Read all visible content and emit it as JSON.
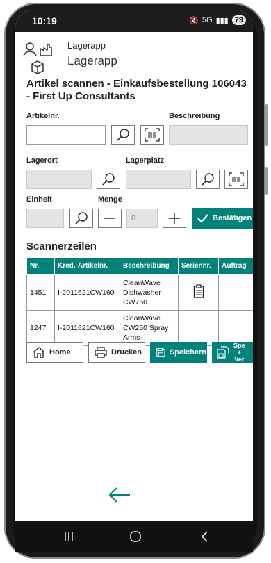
{
  "status": {
    "time": "10:19",
    "signal": "5G",
    "battery": "79"
  },
  "app": {
    "name_small": "Lagerapp",
    "name_large": "Lagerapp"
  },
  "page": {
    "title": "Artikel scannen - Einkaufsbestellung 106043 - First Up Consultants"
  },
  "form": {
    "artikelnr_label": "Artikelnr.",
    "artikelnr_value": "",
    "beschreibung_label": "Beschreibung",
    "lagerort_label": "Lagerort",
    "lagerplatz_label": "Lagerplatz",
    "einheit_label": "Einheit",
    "menge_label": "Menge",
    "menge_value": "0",
    "confirm_label": "Bestätigen"
  },
  "scanner": {
    "title": "Scannerzeilen",
    "columns": [
      "Nr.",
      "Kred.-Artikelnr.",
      "Beschreibung",
      "Seriennr.",
      "Auftrag"
    ],
    "rows": [
      {
        "nr": "1451",
        "kred": "I-2011621CW160",
        "beschreibung": "CleanWave Dishwasher CW750",
        "serien_icon": "clipboard-icon",
        "auftrag": ""
      },
      {
        "nr": "1247",
        "kred": "I-2011621CW160",
        "beschreibung": "CleanWave CW250 Spray Arms",
        "serien_icon": "",
        "auftrag": ""
      }
    ]
  },
  "actions": {
    "home": "Home",
    "print": "Drucken",
    "save": "Speichern",
    "save_send_1": "Spe",
    "save_send_2": "+",
    "save_send_3": "Ver"
  },
  "colors": {
    "accent": "#00827a",
    "statusbar": "#1d1d1d"
  }
}
